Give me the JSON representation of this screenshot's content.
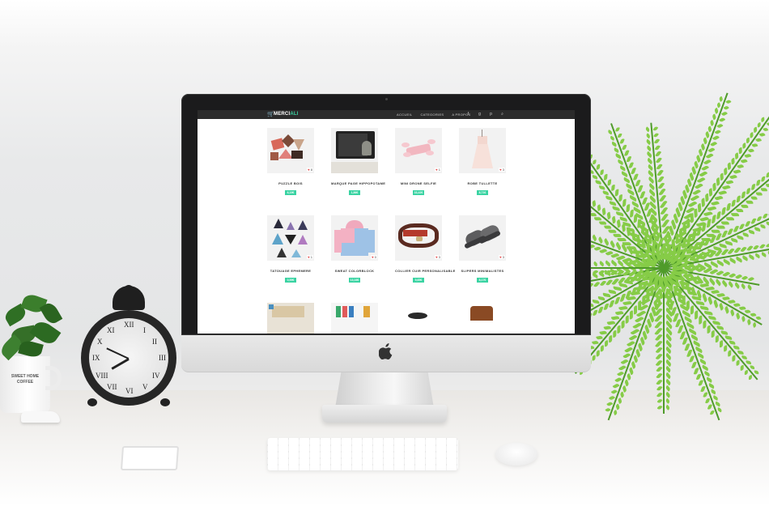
{
  "site": {
    "logo_prefix": "MERCI",
    "logo_suffix": "ALI",
    "nav_links": [
      "ACCUEIL",
      "CATEGORIES",
      "A PROPOS"
    ],
    "nav_icons": [
      "facebook-icon",
      "google-plus-icon",
      "pinterest-icon",
      "search-icon"
    ],
    "accent_color": "#39d3a2"
  },
  "products": [
    {
      "title": "PUZZLE BOIS",
      "price": "6,19€",
      "likes": "8"
    },
    {
      "title": "MARQUE PAGE HIPPOPOTAME",
      "price": "1,86€",
      "likes": ""
    },
    {
      "title": "MINI DRONE SELFIE",
      "price": "33,42€",
      "likes": "1"
    },
    {
      "title": "ROBE TULLETTE",
      "price": "8,71€",
      "likes": "3"
    },
    {
      "title": "TATOUAGE EPHEMERE",
      "price": "0,59€",
      "likes": "1"
    },
    {
      "title": "SWEAT COLORBLOCK",
      "price": "13,16€",
      "likes": "0"
    },
    {
      "title": "COLLIER CUIR PERSONALISABLE",
      "price": "9,65€",
      "likes": "3"
    },
    {
      "title": "SLIPERS MINIMALISTES",
      "price": "8,17€",
      "likes": "3"
    }
  ],
  "desk": {
    "mug_text": "SWEET HOME COFFEE"
  }
}
